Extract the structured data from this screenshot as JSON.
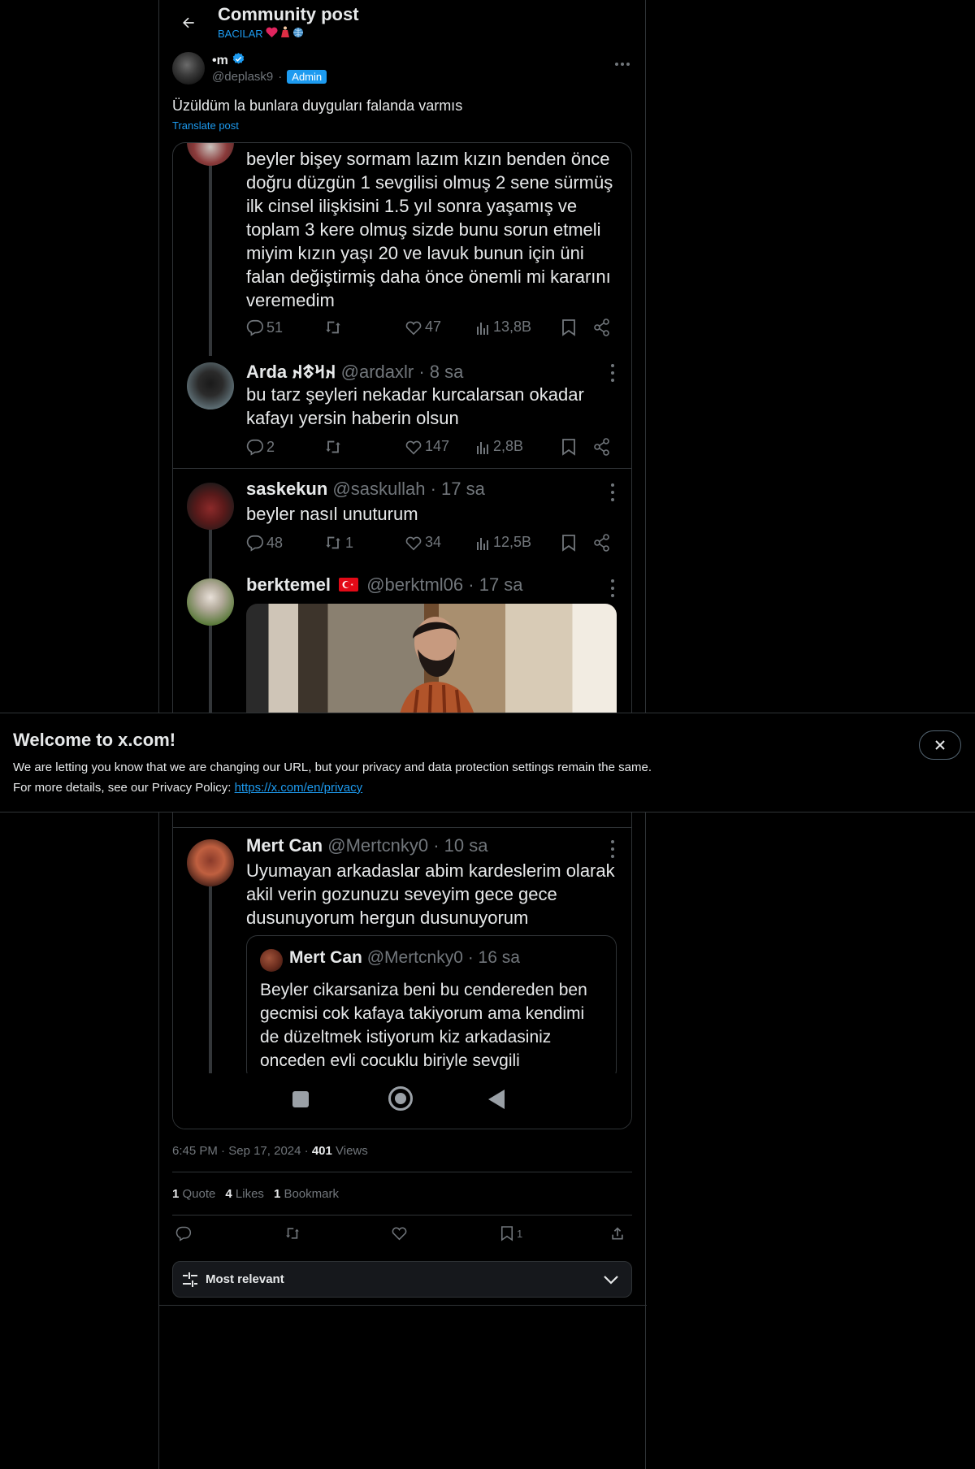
{
  "header": {
    "title": "Community post",
    "community": "BACILAR",
    "emojis": [
      "heart-emoji",
      "dancer-emoji",
      "globe-emoji"
    ]
  },
  "post": {
    "author_name": "•m",
    "author_handle": "@deplask9",
    "separator": "·",
    "role_badge": "Admin",
    "text": "Üzüldüm la bunlara duyguları falanda varmıs",
    "translate_label": "Translate post",
    "time": "6:45 PM",
    "date": "Sep 17, 2024",
    "views_count": "401",
    "views_label": "Views",
    "quote_count": "1",
    "quote_label": "Quote",
    "likes_count": "4",
    "likes_label": "Likes",
    "bookmark_count_stat": "1",
    "bookmark_label": "Bookmark",
    "bookmark_count": "1",
    "sort_label": "Most relevant"
  },
  "screenshot": {
    "tweets": [
      {
        "text": "beyler bişey sormam lazım kızın benden önce doğru düzgün 1 sevgilisi olmuş 2 sene sürmüş ilk cinsel ilişkisini 1.5 yıl sonra yaşamış ve toplam 3 kere olmuş sizde bunu sorun etmeli miyim kızın yaşı 20 ve lavuk bunun için üni falan değiştirmiş daha önce önemli mi kararını veremedim",
        "replies": "51",
        "retweets": "",
        "likes": "47",
        "views": "13,8B"
      },
      {
        "name": "Arda 𐰴𐰺𐱃𐰴",
        "handle": "@ardaxlr",
        "time": "· 8 sa",
        "text": "bu tarz şeyleri nekadar kurcalarsan okadar kafayı yersin haberin olsun",
        "replies": "2",
        "retweets": "",
        "likes": "147",
        "views": "2,8B"
      },
      {
        "name": "saskekun",
        "handle": "@saskullah",
        "time": "· 17 sa",
        "text": "beyler nasıl unuturum",
        "replies": "48",
        "retweets": "1",
        "likes": "34",
        "views": "12,5B"
      },
      {
        "name": "berktemel",
        "flag": "🇹🇷",
        "handle": "@berktml06",
        "time": "· 17 sa"
      },
      {
        "name": "Mert Can",
        "handle": "@Mertcnky0",
        "time": "· 10 sa",
        "text": "Uyumayan arkadaslar abim kardeslerim olarak akil verin gozunuzu seveyim gece gece dusunuyorum hergun dusunuyorum"
      }
    ],
    "quote": {
      "name": "Mert Can",
      "handle": "@Mertcnky0",
      "time": "· 16 sa",
      "text": "Beyler cikarsaniza beni bu cendereden ben gecmisi cok kafaya takiyorum ama kendimi de düzeltmek istiyorum kiz arkadasiniz onceden evli cocuklu biriyle sevgili"
    }
  },
  "banner": {
    "title": "Welcome to x.com!",
    "line1": "We are letting you know that we are changing our URL, but your privacy and data protection settings remain the same.",
    "line2_prefix": "For more details, see our Privacy Policy: ",
    "link": "https://x.com/en/privacy"
  },
  "colors": {
    "accent": "#1d9bf0",
    "muted": "#71767b",
    "border": "#2f3336",
    "bg": "#000000"
  }
}
